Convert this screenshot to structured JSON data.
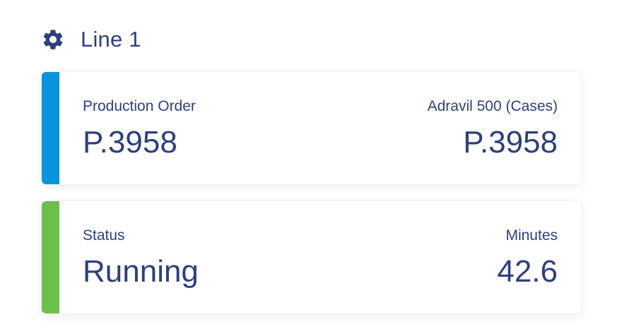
{
  "header": {
    "icon": "gear-icon",
    "title": "Line 1"
  },
  "cards": [
    {
      "accent_color": "#0a94de",
      "left_label": "Production Order",
      "left_value": "P.3958",
      "right_label": "Adravil 500 (Cases)",
      "right_value": "P.3958"
    },
    {
      "accent_color": "#6cc04a",
      "left_label": "Status",
      "left_value": "Running",
      "right_label": "Minutes",
      "right_value": "42.6"
    }
  ],
  "colors": {
    "text": "#2e3f7c",
    "background": "#ffffff"
  }
}
